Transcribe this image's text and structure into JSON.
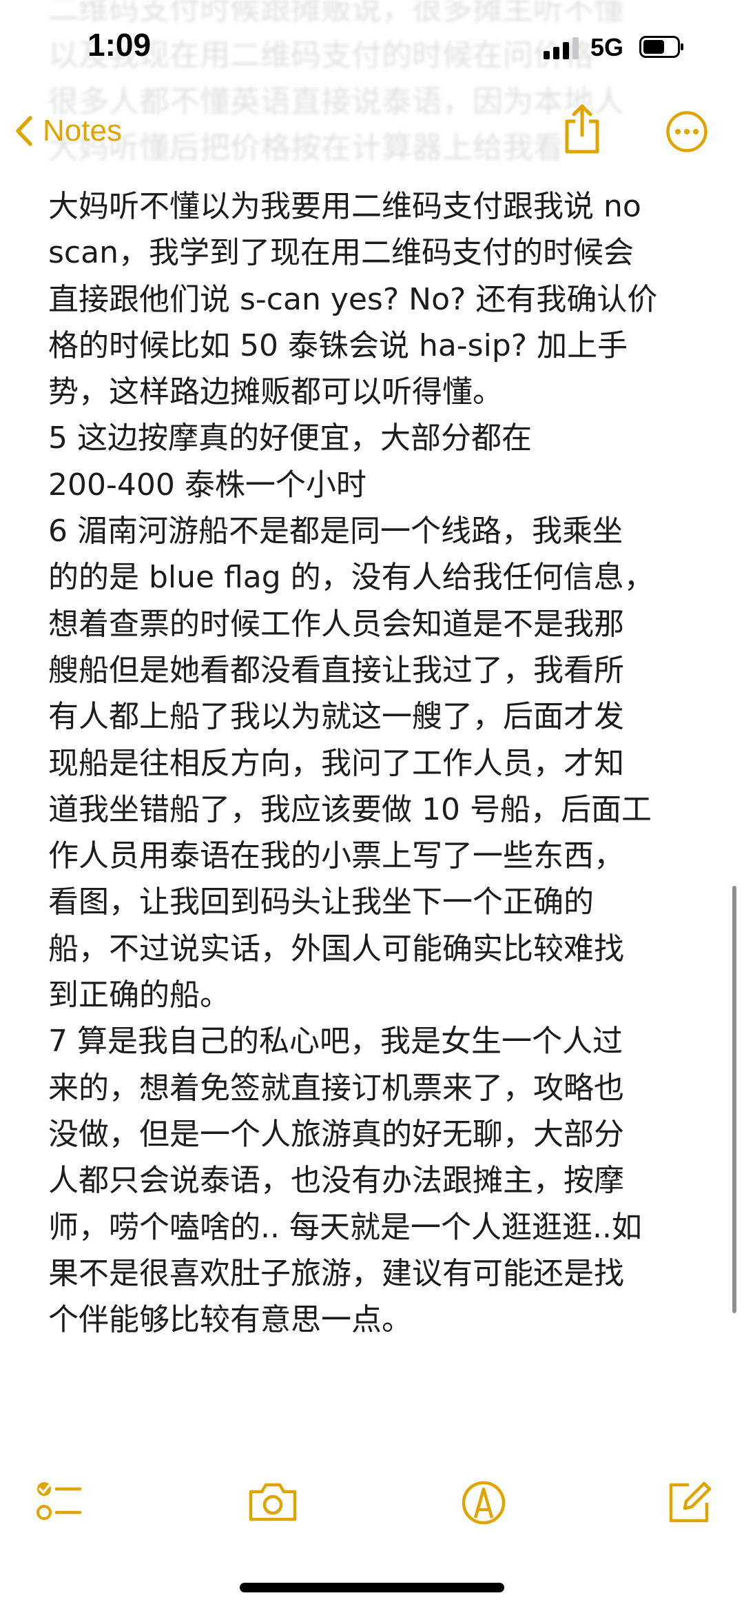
{
  "status_bar": {
    "time": "1:09",
    "network": "5G"
  },
  "nav": {
    "back_label": "Notes"
  },
  "note": {
    "lines": [
      "大妈听不懂以为我要用二维码支付跟我说 no",
      "scan，我学到了现在用二维码支付的时候会",
      "直接跟他们说 s-can yes? No? 还有我确认价",
      "格的时候比如 50 泰铢会说 ha-sip? 加上手",
      "势，这样路边摊贩都可以听得懂。",
      "5 这边按摩真的好便宜，大部分都在",
      "200-400 泰株一个小时",
      "6 湄南河游船不是都是同一个线路，我乘坐",
      "的的是 blue flag 的，没有人给我任何信息，",
      "想着查票的时候工作人员会知道是不是我那",
      "艘船但是她看都没看直接让我过了，我看所",
      "有人都上船了我以为就这一艘了，后面才发",
      "现船是往相反方向，我问了工作人员，才知",
      "道我坐错船了，我应该要做 10 号船，后面工",
      "作人员用泰语在我的小票上写了一些东西，",
      "看图，让我回到码头让我坐下一个正确的",
      "船，不过说实话，外国人可能确实比较难找",
      "到正确的船。",
      "7 算是我自己的私心吧，我是女生一个人过",
      "来的，想着免签就直接订机票来了，攻略也",
      "没做，但是一个人旅游真的好无聊，大部分",
      "人都只会说泰语，也没有办法跟摊主，按摩",
      "师，唠个嗑啥的.. 每天就是一个人逛逛逛..如",
      "果不是很喜欢肚子旅游，建议有可能还是找",
      "个伴能够比较有意思一点。"
    ]
  },
  "colors": {
    "accent": "#e0a400",
    "text": "#1c1c1e",
    "background": "#ffffff"
  },
  "icons": {
    "back": "chevron-left-icon",
    "share": "share-icon",
    "more": "ellipsis-circle-icon",
    "checklist": "checklist-icon",
    "camera": "camera-icon",
    "markup": "pen-markup-icon",
    "compose": "compose-icon"
  }
}
